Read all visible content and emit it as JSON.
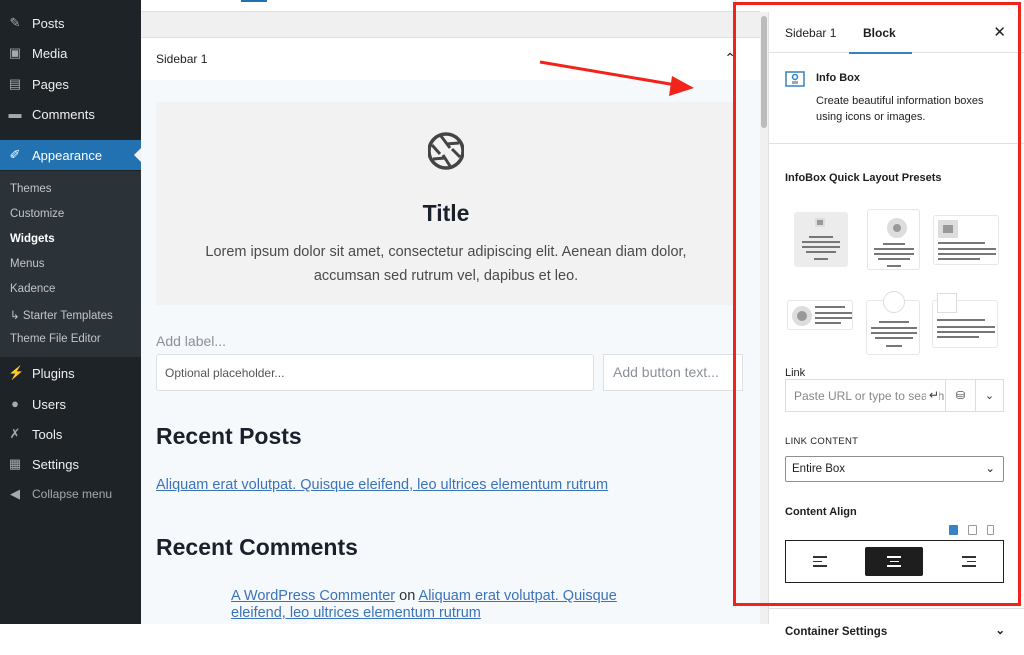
{
  "admin_menu": {
    "items": [
      {
        "label": "Posts",
        "icon": "pin-icon"
      },
      {
        "label": "Media",
        "icon": "media-icon"
      },
      {
        "label": "Pages",
        "icon": "pages-icon"
      },
      {
        "label": "Comments",
        "icon": "comment-icon"
      },
      {
        "label": "Appearance",
        "icon": "brush-icon"
      },
      {
        "label": "Plugins",
        "icon": "plug-icon"
      },
      {
        "label": "Users",
        "icon": "user-icon"
      },
      {
        "label": "Tools",
        "icon": "wrench-icon"
      },
      {
        "label": "Settings",
        "icon": "settings-icon"
      },
      {
        "label": "Collapse menu",
        "icon": "collapse-icon"
      }
    ],
    "submenu": [
      "Themes",
      "Customize",
      "Widgets",
      "Menus",
      "Kadence",
      "↳ Starter Templates",
      "Theme File Editor"
    ],
    "active": "Appearance",
    "current_sub": "Widgets"
  },
  "editor": {
    "area_title": "Sidebar 1",
    "infobox": {
      "title": "Title",
      "text": "Lorem ipsum dolor sit amet, consectetur adipiscing elit. Aenean diam dolor, accumsan sed rutrum vel, dapibus et leo."
    },
    "search": {
      "label_placeholder": "Add label...",
      "input_placeholder": "Optional placeholder...",
      "button_placeholder": "Add button text..."
    },
    "recent_posts": {
      "title": "Recent Posts",
      "link": "Aliquam erat volutpat. Quisque eleifend, leo ultrices elementum rutrum"
    },
    "recent_comments": {
      "title": "Recent Comments",
      "author": "A WordPress Commenter",
      "on": "on",
      "post": "Aliquam erat volutpat. Quisque eleifend, leo ultrices elementum rutrum"
    }
  },
  "panel": {
    "tabs": [
      "Sidebar 1",
      "Block"
    ],
    "active_tab": "Block",
    "block": {
      "name": "Info Box",
      "description": "Create beautiful information boxes using icons or images."
    },
    "presets_title": "InfoBox Quick Layout Presets",
    "link_label": "Link",
    "link_placeholder": "Paste URL or type to search",
    "link_content_label": "LINK CONTENT",
    "link_content_value": "Entire Box",
    "content_align_label": "Content Align",
    "content_align_value": "center",
    "device": "desktop",
    "container_settings": "Container Settings"
  },
  "colors": {
    "accent": "#2271b1",
    "annotation": "#f0241a"
  }
}
